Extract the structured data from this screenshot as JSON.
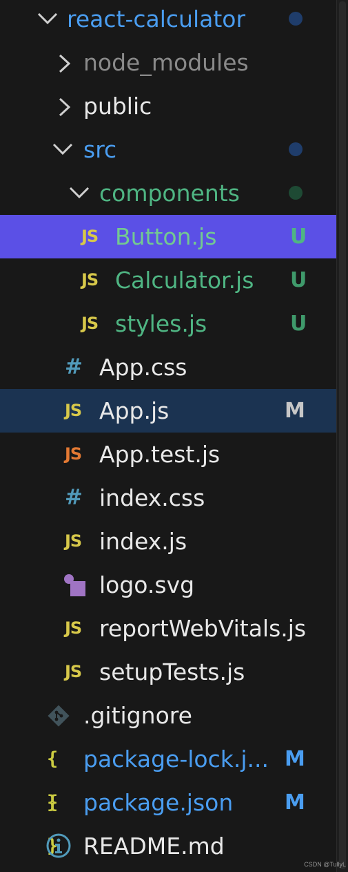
{
  "explorer": {
    "root": {
      "label": "react-calculator",
      "dot_color": "#1f3d6b"
    },
    "node_modules": {
      "label": "node_modules"
    },
    "public": {
      "label": "public"
    },
    "src": {
      "label": "src",
      "dot_color": "#1f3d6b"
    },
    "components": {
      "label": "components",
      "dot_color": "#1e4a34"
    },
    "files": {
      "button_js": {
        "icon": "JS",
        "label": "Button.js",
        "badge": "U"
      },
      "calculator_js": {
        "icon": "JS",
        "label": "Calculator.js",
        "badge": "U"
      },
      "styles_js": {
        "icon": "JS",
        "label": "styles.js",
        "badge": "U"
      },
      "app_css": {
        "icon": "#",
        "label": "App.css"
      },
      "app_js": {
        "icon": "JS",
        "label": "App.js",
        "badge": "M"
      },
      "app_test_js": {
        "icon": "JS",
        "label": "App.test.js"
      },
      "index_css": {
        "icon": "#",
        "label": "index.css"
      },
      "index_js": {
        "icon": "JS",
        "label": "index.js"
      },
      "logo_svg": {
        "label": "logo.svg"
      },
      "report_web_vitals_js": {
        "icon": "JS",
        "label": "reportWebVitals.js"
      },
      "setup_tests_js": {
        "icon": "JS",
        "label": "setupTests.js"
      },
      "gitignore": {
        "label": ".gitignore"
      },
      "package_lock_json": {
        "icon": "{ }",
        "label": "package-lock.j...",
        "badge": "M"
      },
      "package_json": {
        "icon": "{ }",
        "label": "package.json",
        "badge": "M"
      },
      "readme_md": {
        "label": "README.md"
      }
    }
  },
  "watermark": "CSDN @TullyL",
  "colors": {
    "background": "#181818",
    "selected_row": "#5b50e6",
    "active_row": "#1b3351",
    "folder_modified": "#4a9df0",
    "untracked": "#4fb583",
    "js_icon": "#d7c84a",
    "css_icon": "#519aba"
  }
}
